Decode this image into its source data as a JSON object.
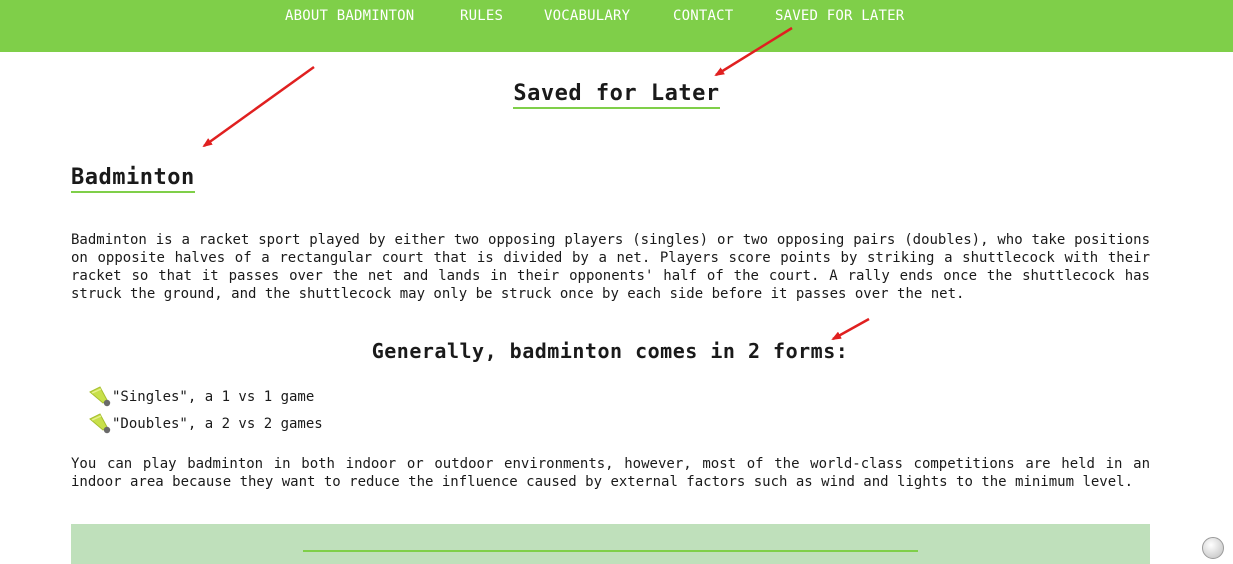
{
  "nav": {
    "items": [
      {
        "label": "ABOUT BADMINTON"
      },
      {
        "label": "RULES"
      },
      {
        "label": "VOCABULARY"
      },
      {
        "label": "CONTACT"
      },
      {
        "label": "SAVED FOR LATER"
      }
    ]
  },
  "page": {
    "title": "Saved for Later"
  },
  "section": {
    "title": "Badminton",
    "intro": "Badminton is a racket sport played by either two opposing players (singles) or two opposing pairs (doubles), who take positions on opposite halves of a rectangular court that is divided by a net. Players score points by striking a shuttlecock with their racket so that it passes over the net and lands in their opponents' half of the court. A rally ends once the shuttlecock has struck the ground, and the shuttlecock may only be struck once by each side before it passes over the net.",
    "subheading": "Generally, badminton comes in 2 forms:",
    "forms": [
      {
        "text": "\"Singles\", a 1 vs 1 game",
        "icon": "shuttlecock-icon"
      },
      {
        "text": "\"Doubles\", a 2 vs 2 games",
        "icon": "shuttlecock-icon"
      }
    ],
    "environment": "You can play badminton in both indoor or outdoor environments, however, most of the world-class competitions are held in an indoor area because they want to reduce the influence caused by external factors such as wind and lights to the minimum level."
  },
  "colors": {
    "nav_bg": "#7fcf49",
    "accent": "#7fcf49",
    "panel_bg": "#bfe0bb",
    "annotation_arrow": "#e02020"
  }
}
